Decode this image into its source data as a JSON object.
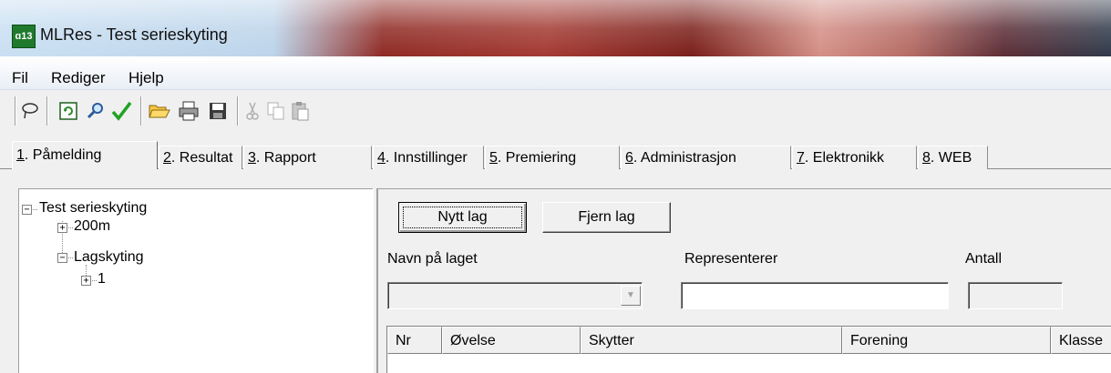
{
  "window": {
    "title": "MLRes - Test serieskyting",
    "app_icon_label": "ɑ13"
  },
  "menu": {
    "items": [
      "Fil",
      "Rediger",
      "Hjelp"
    ]
  },
  "toolbar": {
    "buttons": [
      {
        "icon": "lasso-icon"
      },
      {
        "icon": "refresh-icon"
      },
      {
        "icon": "search-icon"
      },
      {
        "icon": "check-icon"
      },
      {
        "icon": "open-folder-icon"
      },
      {
        "icon": "print-icon"
      },
      {
        "icon": "save-icon"
      },
      {
        "icon": "cut-icon",
        "disabled": true
      },
      {
        "icon": "copy-icon",
        "disabled": true
      },
      {
        "icon": "paste-icon",
        "disabled": true
      }
    ]
  },
  "tabs": [
    {
      "key": "1",
      "label": ". Påmelding",
      "active": true
    },
    {
      "key": "2",
      "label": ". Resultat"
    },
    {
      "key": "3",
      "label": ". Rapport"
    },
    {
      "key": "4",
      "label": ". Innstillinger"
    },
    {
      "key": "5",
      "label": ". Premiering"
    },
    {
      "key": "6",
      "label": ". Administrasjon"
    },
    {
      "key": "7",
      "label": ". Elektronikk"
    },
    {
      "key": "8",
      "label": ". WEB"
    }
  ],
  "tree": {
    "root": "Test serieskyting",
    "children": [
      {
        "label": "200m",
        "expanded": false
      },
      {
        "label": "Lagskyting",
        "expanded": true,
        "children": [
          {
            "label": "1",
            "expanded": false
          }
        ]
      }
    ]
  },
  "form": {
    "new_team_button": "Nytt lag",
    "remove_team_button": "Fjern lag",
    "team_name_label": "Navn på laget",
    "represents_label": "Representerer",
    "count_label": "Antall",
    "team_name_value": "",
    "represents_value": "",
    "count_value": ""
  },
  "grid": {
    "columns": [
      "Nr",
      "Øvelse",
      "Skytter",
      "Forening",
      "Klasse"
    ],
    "rows": []
  }
}
